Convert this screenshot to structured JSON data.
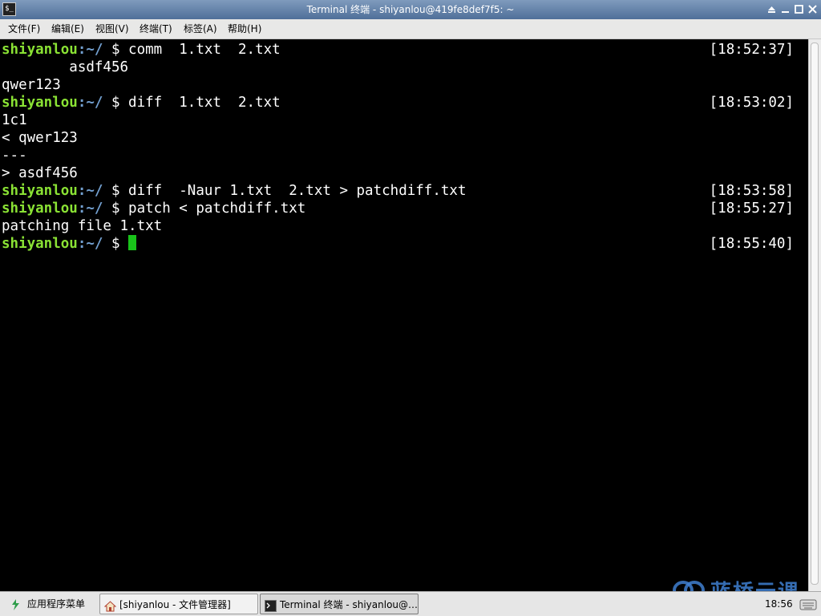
{
  "window": {
    "title": "Terminal 终端 - shiyanlou@419fe8def7f5: ~",
    "icons": [
      "terminal-icon",
      "shade-icon",
      "minimize-icon",
      "maximize-icon",
      "close-icon"
    ]
  },
  "menu": {
    "file": "文件(F)",
    "edit": "编辑(E)",
    "view": "视图(V)",
    "terminal": "终端(T)",
    "tabs": "标签(A)",
    "help": "帮助(H)"
  },
  "terminal": {
    "user": "shiyanlou",
    "path": ":~/",
    "line1_cmd": " $ comm  1.txt  2.txt",
    "line1_ts": "[18:52:37]",
    "line2": "        asdf456",
    "line3": "qwer123",
    "line4_cmd": " $ diff  1.txt  2.txt",
    "line4_ts": "[18:53:02]",
    "line5": "1c1",
    "line6": "< qwer123",
    "line7": "---",
    "line8": "> asdf456",
    "line9_cmd": " $ diff  -Naur 1.txt  2.txt > patchdiff.txt",
    "line9_ts": "[18:53:58]",
    "line10_cmd": " $ patch < patchdiff.txt",
    "line10_ts": "[18:55:27]",
    "line11": "patching file 1.txt",
    "line12_cmd": " $ ",
    "line12_ts": "[18:55:40]",
    "colors": {
      "user": "#8ae234",
      "path": "#729fcf",
      "cursor": "#19c31a",
      "background": "#000000"
    }
  },
  "watermark": {
    "text": "蓝桥云课"
  },
  "taskbar": {
    "app_menu": "应用程序菜单",
    "file_manager": "[shiyanlou - 文件管理器]",
    "terminal_task": "Terminal 终端 - shiyanlou@…",
    "clock": "18:56"
  }
}
